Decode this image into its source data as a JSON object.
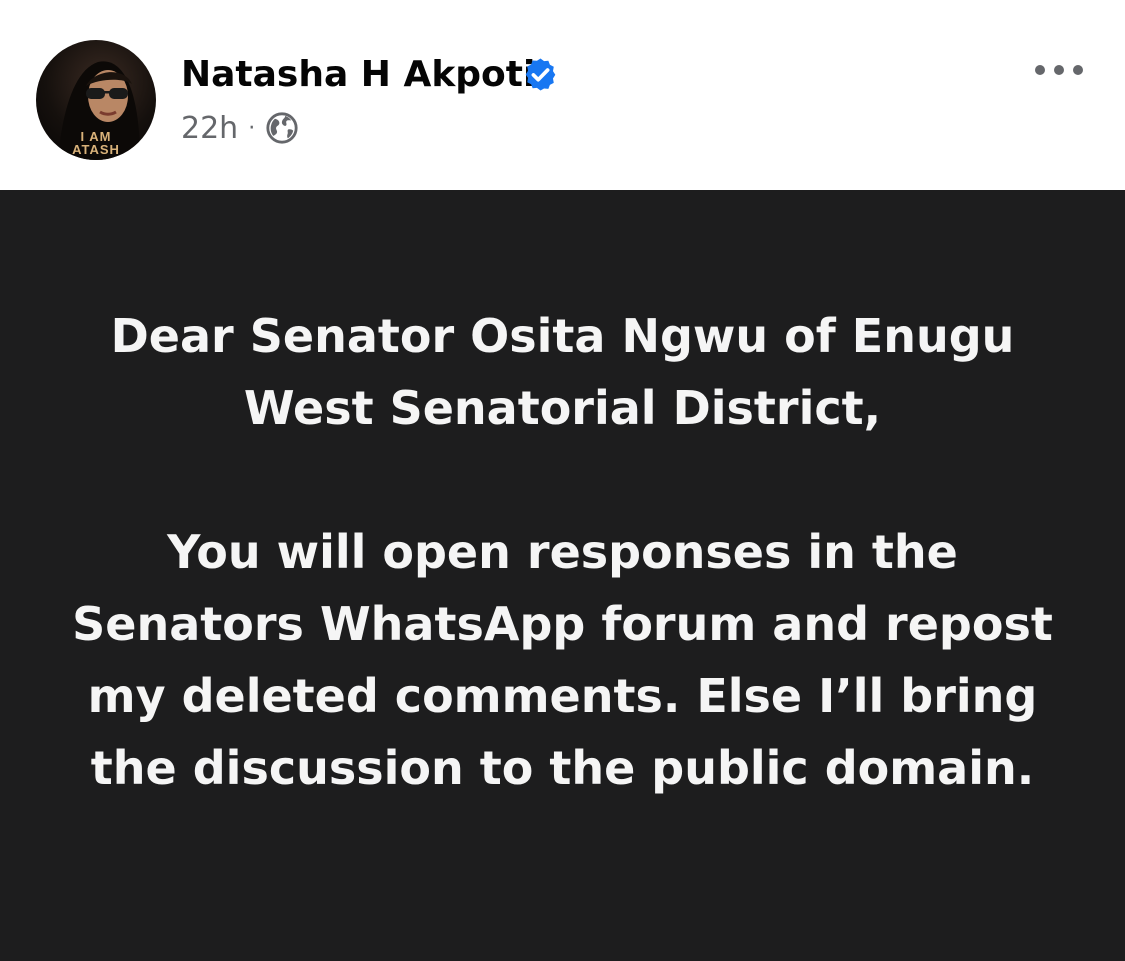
{
  "post": {
    "author": {
      "name": "Natasha H Akpoti",
      "verified": true,
      "avatar_caption": [
        "I AM",
        "ATASH"
      ]
    },
    "timestamp": "22h",
    "separator": "·",
    "audience_icon": "globe-icon",
    "more_icon": "more-horizontal-icon",
    "content": {
      "paragraph_1": "Dear Senator Osita Ngwu of Enugu West Senatorial District,",
      "paragraph_2": "You will open responses in the Senators WhatsApp forum and repost my deleted comments. Else I’ll bring the discussion to the public domain."
    }
  },
  "colors": {
    "verified_badge": "#1877f2",
    "post_background": "#1d1d1e",
    "post_text": "#f5f5f5",
    "meta_text": "#65676b"
  }
}
